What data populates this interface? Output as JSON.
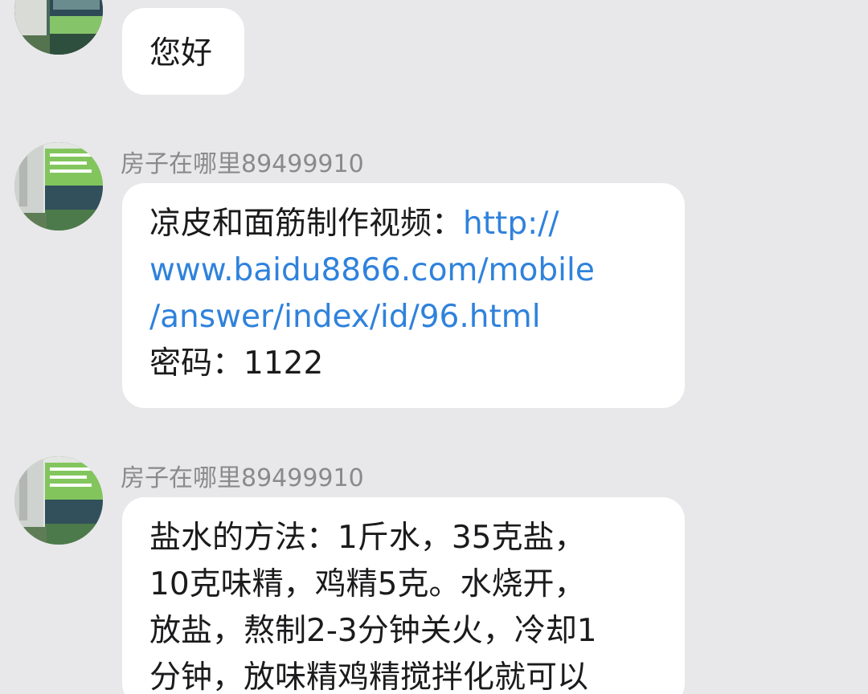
{
  "messages": [
    {
      "sender": "",
      "lines": [
        {
          "text": "您好"
        }
      ]
    },
    {
      "sender": "房子在哪里89499910",
      "line1_prefix": "凉皮和面筋制作视频：",
      "line1_link": "http://",
      "link_line2": "www.baidu8866.com/mobile",
      "link_line3": "/answer/index/id/96.html",
      "line4": "密码：1122"
    },
    {
      "sender": "房子在哪里89499910",
      "lines": [
        "盐水的方法：1斤水，35克盐，",
        "10克味精，鸡精5克。水烧开，",
        "放盐，熬制2-3分钟关火，冷却1",
        "分钟，放味精鸡精搅拌化就可以"
      ]
    }
  ],
  "colors": {
    "background": "#e8e8ea",
    "bubble": "#ffffff",
    "link": "#2f82dc",
    "sender": "#8a8a8d"
  },
  "icons": {
    "avatar": "user-avatar-photo"
  }
}
